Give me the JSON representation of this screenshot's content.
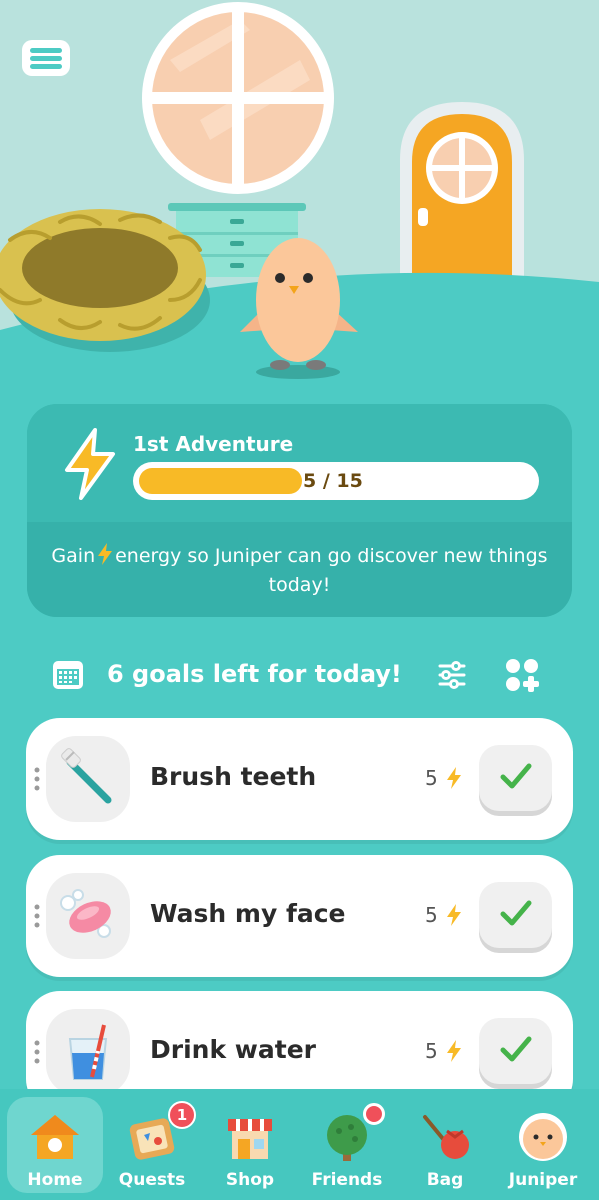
{
  "scene": {
    "colors": {
      "wall": "#b9e2dd",
      "floor": "#4dcbc4",
      "window": "#f8cfb0",
      "door": "#f5a623",
      "nest": "#d9c14f",
      "chick": "#fbc79a"
    }
  },
  "adventure": {
    "title": "1st Adventure",
    "progress": {
      "current": 5,
      "total": 15,
      "text": "5 / 15"
    },
    "message_before": "Gain",
    "message_after": "energy so Juniper can go discover new things today!"
  },
  "goals": {
    "header": "6 goals left for today!",
    "items": [
      {
        "label": "Brush teeth",
        "points": "5",
        "icon": "toothbrush-icon"
      },
      {
        "label": "Wash my face",
        "points": "5",
        "icon": "soap-icon"
      },
      {
        "label": "Drink water",
        "points": "5",
        "icon": "water-glass-icon"
      }
    ]
  },
  "nav": {
    "items": [
      {
        "label": "Home",
        "icon": "birdhouse-icon",
        "active": true
      },
      {
        "label": "Quests",
        "icon": "quest-board-icon",
        "badge": "1"
      },
      {
        "label": "Shop",
        "icon": "shop-icon"
      },
      {
        "label": "Friends",
        "icon": "tree-icon",
        "dot": true
      },
      {
        "label": "Bag",
        "icon": "bag-icon"
      },
      {
        "label": "Juniper",
        "icon": "juniper-avatar-icon"
      }
    ]
  },
  "colors": {
    "accent": "#4dcbc4",
    "energy": "#f8ba26",
    "check": "#45b34a",
    "badge": "#f0505a"
  }
}
